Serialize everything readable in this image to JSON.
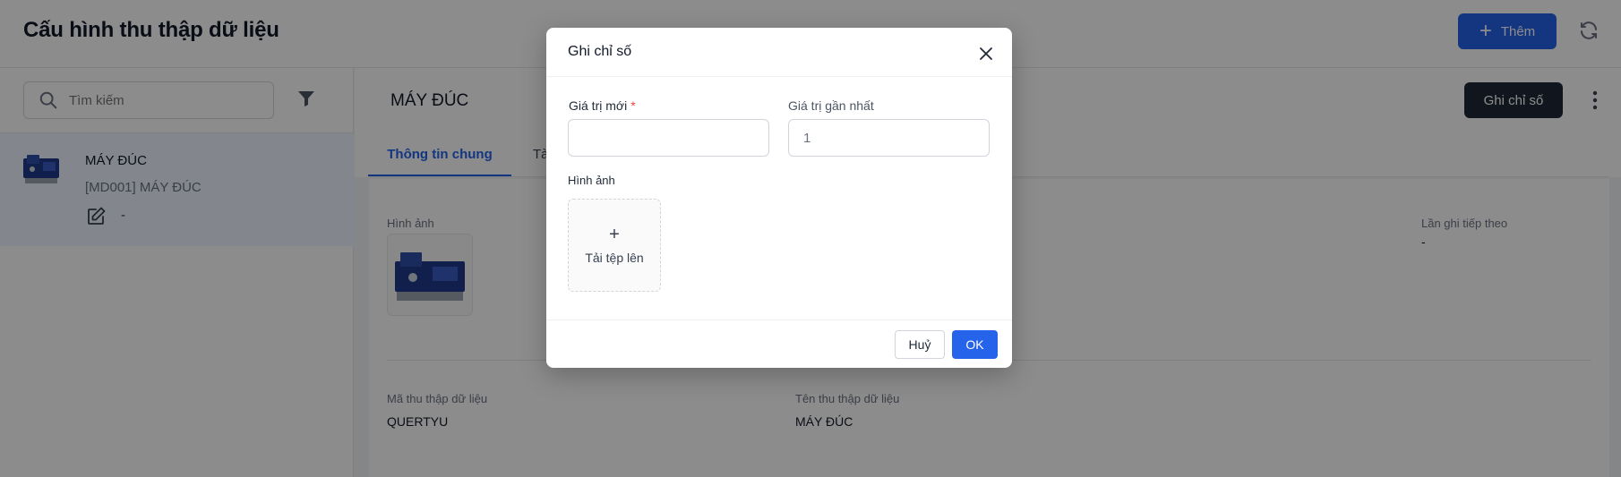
{
  "header": {
    "title": "Cấu hình thu thập dữ liệu",
    "add_label": "Thêm"
  },
  "sidebar": {
    "search_placeholder": "Tìm kiếm",
    "items": [
      {
        "name": "MÁY ĐÚC",
        "code": "[MD001] MÁY ĐÚC",
        "extra": "-"
      }
    ]
  },
  "main": {
    "title": "MÁY ĐÚC",
    "record_label": "Ghi chỉ số",
    "tabs": [
      {
        "label": "Thông tin chung",
        "active": true
      },
      {
        "label": "Tà",
        "active": false
      }
    ],
    "fields": {
      "image_label": "Hình ảnh",
      "next_record_label": "Lần ghi tiếp theo",
      "next_record_value": "-",
      "code_label": "Mã thu thập dữ liệu",
      "code_value": "QUERTYU",
      "name_label": "Tên thu thập dữ liệu",
      "name_value": "MÁY ĐÚC"
    }
  },
  "modal": {
    "title": "Ghi chỉ số",
    "new_value_label": "Giá trị mới",
    "new_value": "",
    "recent_value_label": "Giá trị gần nhất",
    "recent_value": "1",
    "image_label": "Hình ảnh",
    "upload_label": "Tải tệp lên",
    "cancel_label": "Huỷ",
    "ok_label": "OK"
  },
  "colors": {
    "primary": "#2563eb",
    "dark_button": "#1f2937",
    "required": "#ef4444"
  }
}
